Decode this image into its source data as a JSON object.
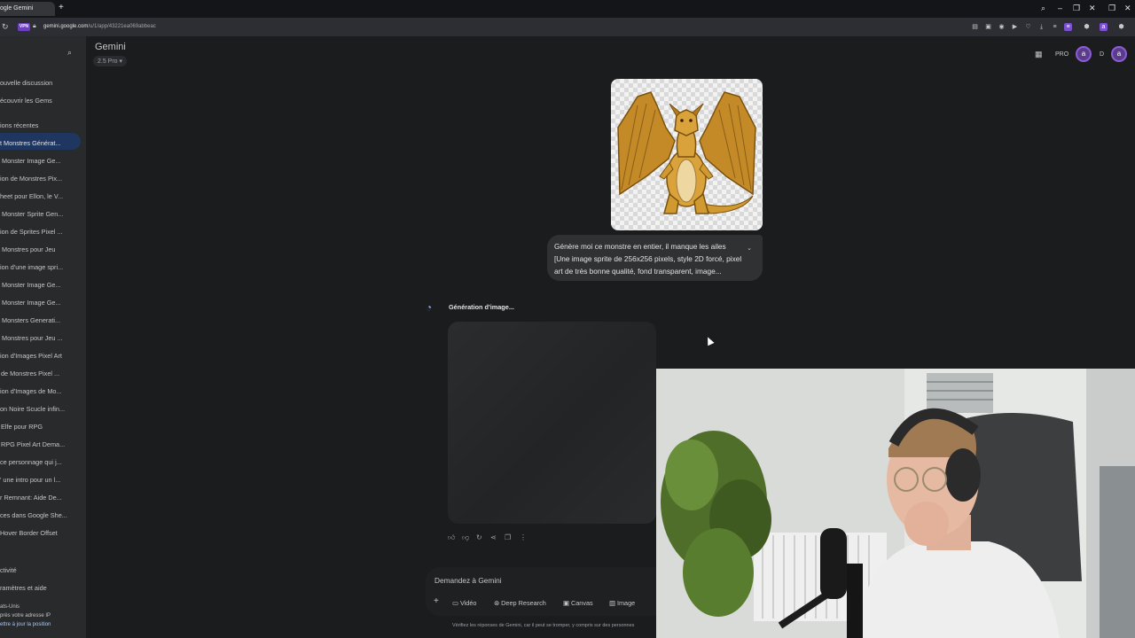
{
  "browser": {
    "tab_title": "ogle Gemini",
    "url_host": "gemini.google.com",
    "url_path": "/u/1/app/43221ea069abbeac",
    "vpn_badge": "VPN"
  },
  "sidebar": {
    "new_chat": "ouvelle discussion",
    "discover_gems": "écouvrir les Gems",
    "recent_header": "ions récentes",
    "items": [
      "t Monstres Générat...",
      "Monster Image Ge...",
      "ion de Monstres Pix...",
      "heet pour Ellon, le V...",
      "Monster Sprite Gen...",
      "ion de Sprites Pixel ...",
      "Monstres pour Jeu",
      "ion d'une image spri...",
      "Monster Image Ge...",
      "Monster Image Ge...",
      "Monsters Generati...",
      "Monstres pour Jeu ...",
      "ion d'Images Pixel Art",
      "de Monstres Pixel ...",
      "ion d'Images de Mo...",
      "on Noire Scucle infin...",
      "Elfe pour RPG",
      "RPG Pixel Art Dema...",
      "ce personnage qui j...",
      "' une intro pour un l...",
      "r Remnant: Aide De...",
      "ces dans Google She...",
      "Hover Border Offset"
    ],
    "activity": "ctivité",
    "settings": "ramètres et aide",
    "location_name": "ats-Unis",
    "location_ip": "près votre adresse IP",
    "location_update": "ettre à jour la position"
  },
  "header": {
    "app_title": "Gemini",
    "model_label": "2.5 Pro",
    "pro_label": "PRO",
    "avatar_letter": "a",
    "extra_letter": "D"
  },
  "chat": {
    "user_message_lines": [
      "Génère moi ce monstre en entier, il manque les ailes",
      "[Une image sprite de 256x256 pixels, style 2D forcé, pixel",
      "art de très bonne qualité, fond transparent, image..."
    ],
    "generating_label": "Génération d'image..."
  },
  "input": {
    "placeholder": "Demandez à Gemini",
    "tools": [
      "Vidéo",
      "Deep Research",
      "Canvas",
      "Image"
    ],
    "disclaimer": "Vérifiez les réponses de Gemini, car il peut se tromper, y compris sur des personnes"
  },
  "colors": {
    "background": "#1b1c1d",
    "sidebar": "#282a2c",
    "active_item": "#1f3760",
    "accent_purple": "#8e5cd9"
  }
}
